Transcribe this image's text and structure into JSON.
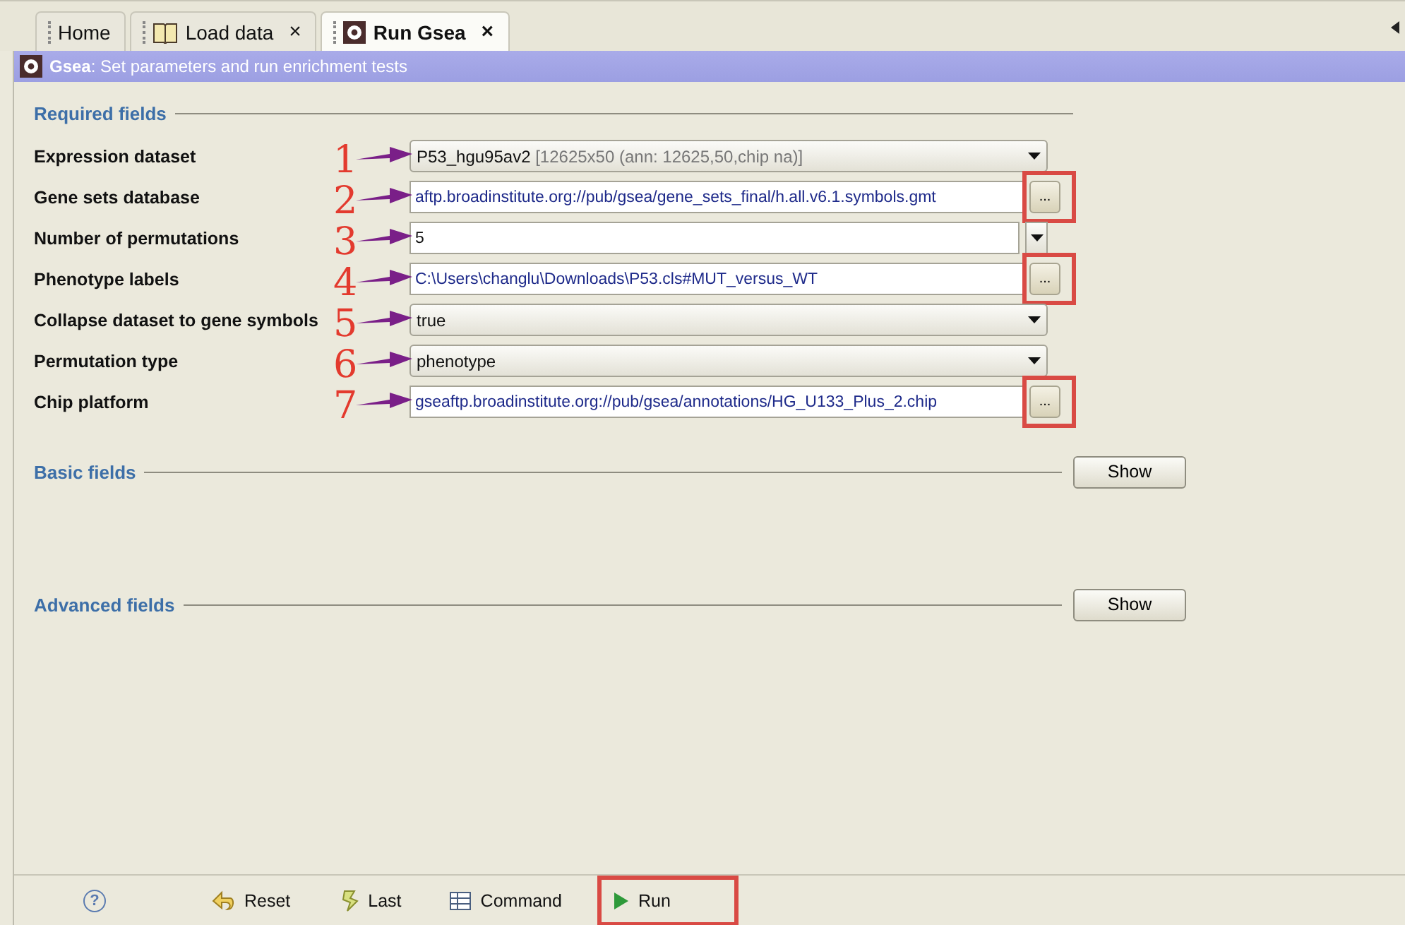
{
  "tabs": [
    {
      "label": "Home",
      "icon": false,
      "closable": false,
      "selected": false
    },
    {
      "label": "Load data",
      "icon": true,
      "closable": true,
      "selected": false
    },
    {
      "label": "Run Gsea",
      "icon": true,
      "closable": true,
      "selected": true
    }
  ],
  "close_glyph": "×",
  "header": {
    "text": "**Gsea**: Set parameters and run enrichment tests"
  },
  "required": {
    "title": "Required fields",
    "fields": [
      {
        "label": "Expression dataset",
        "kind": "dropdown",
        "value": "P53_hgu95av2",
        "detail": "[12625x50 (ann: 12625,50,chip na)]",
        "marker": "1"
      },
      {
        "label": "Gene sets database",
        "kind": "file",
        "value": "aftp.broadinstitute.org://pub/gsea/gene_sets_final/h.all.v6.1.symbols.gmt",
        "button": "...",
        "marker": "2",
        "highlighted": true
      },
      {
        "label": "Number of permutations",
        "kind": "combo",
        "value": "5",
        "marker": "3"
      },
      {
        "label": "Phenotype labels",
        "kind": "file",
        "value": "C:\\Users\\changlu\\Downloads\\P53.cls#MUT_versus_WT",
        "button": "...",
        "marker": "4",
        "highlighted": true
      },
      {
        "label": "Collapse dataset to gene symbols",
        "kind": "dropdown",
        "value": "true",
        "marker": "5"
      },
      {
        "label": "Permutation type",
        "kind": "dropdown",
        "value": "phenotype",
        "marker": "6"
      },
      {
        "label": "Chip platform",
        "kind": "file",
        "value": "gseaftp.broadinstitute.org://pub/gsea/annotations/HG_U133_Plus_2.chip",
        "button": "...",
        "marker": "7",
        "highlighted": true
      }
    ]
  },
  "sections": [
    {
      "title": "Basic fields",
      "button": "Show"
    },
    {
      "title": "Advanced fields",
      "button": "Show"
    }
  ],
  "toolbar": [
    {
      "kind": "help",
      "label": "?",
      "highlighted": false
    },
    {
      "kind": "reset",
      "label": "Reset",
      "highlighted": false
    },
    {
      "kind": "last",
      "label": "Last",
      "highlighted": false
    },
    {
      "kind": "command",
      "label": "Command",
      "highlighted": false
    },
    {
      "kind": "run",
      "label": "Run",
      "highlighted": true
    }
  ]
}
